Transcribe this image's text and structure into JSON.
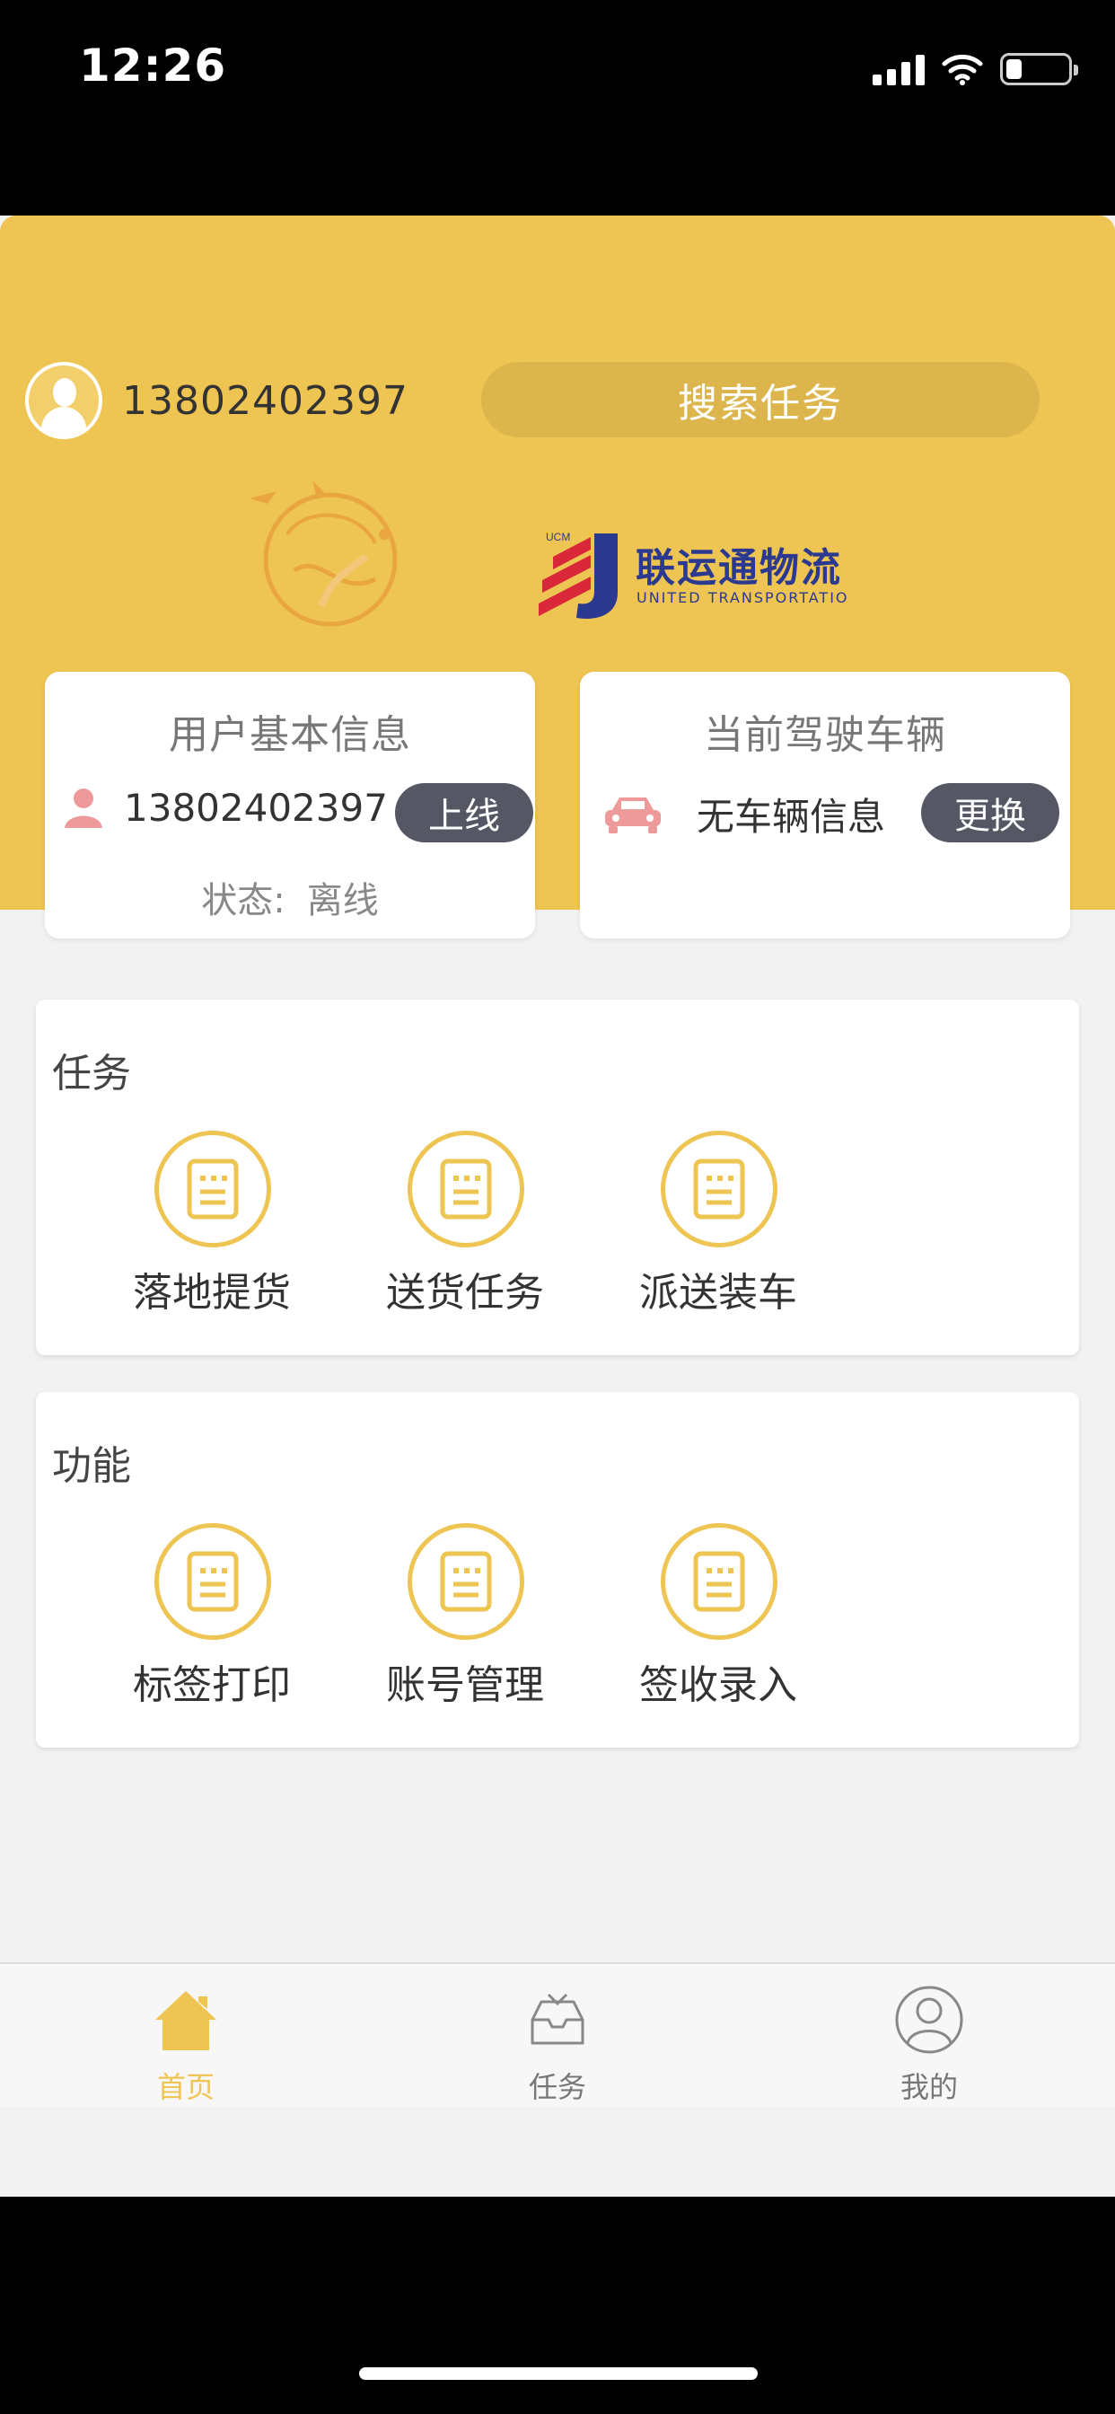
{
  "status_bar": {
    "time": "12:26",
    "battery_level": 0.26
  },
  "header": {
    "user_phone": "13802402397",
    "search_button_label": "搜索任务",
    "partner_logo_cn": "联运通物流",
    "partner_logo_en": "UNITED TRANSPORTATIO",
    "partner_logo_badge": "UCM"
  },
  "user_card": {
    "title": "用户基本信息",
    "phone": "13802402397",
    "online_button": "上线",
    "status_label": "状态:",
    "status_value": "离线"
  },
  "vehicle_card": {
    "title": "当前驾驶车辆",
    "vehicle_text": "无车辆信息",
    "change_button": "更换"
  },
  "tasks_section": {
    "title": "任务",
    "items": [
      {
        "label": "落地提货",
        "icon": "document-icon"
      },
      {
        "label": "送货任务",
        "icon": "document-icon"
      },
      {
        "label": "派送装车",
        "icon": "document-icon"
      }
    ]
  },
  "functions_section": {
    "title": "功能",
    "items": [
      {
        "label": "标签打印",
        "icon": "document-icon"
      },
      {
        "label": "账号管理",
        "icon": "document-icon"
      },
      {
        "label": "签收录入",
        "icon": "document-icon"
      }
    ]
  },
  "tab_bar": {
    "items": [
      {
        "label": "首页",
        "icon": "home-icon",
        "active": true
      },
      {
        "label": "任务",
        "icon": "inbox-icon",
        "active": false
      },
      {
        "label": "我的",
        "icon": "user-circle-icon",
        "active": false
      }
    ]
  },
  "colors": {
    "brand_yellow": "#eec452",
    "pill_dark": "#555864",
    "background": "#f2f2f2",
    "logo_blue": "#2b3990",
    "logo_red": "#d8283a"
  }
}
